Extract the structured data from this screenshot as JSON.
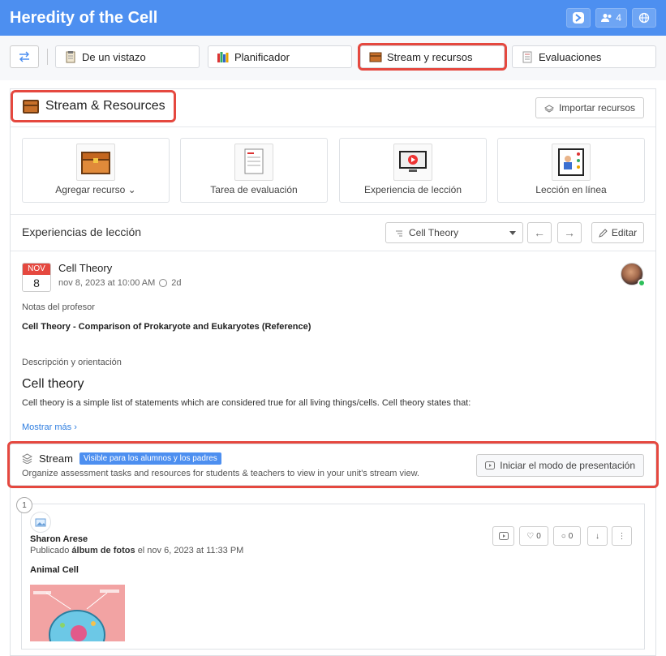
{
  "app": {
    "title": "Heredity of the Cell",
    "members_count": "4"
  },
  "tabs": [
    {
      "label": "De un vistazo"
    },
    {
      "label": "Planificador"
    },
    {
      "label": "Stream y recursos"
    },
    {
      "label": "Evaluaciones"
    }
  ],
  "header": {
    "title": "Stream & Resources",
    "import_label": "Importar recursos"
  },
  "cards": [
    {
      "label": "Agregar recurso"
    },
    {
      "label": "Tarea de evaluación"
    },
    {
      "label": "Experiencia de lección"
    },
    {
      "label": "Lección en línea"
    }
  ],
  "lessons": {
    "heading": "Experiencias de lección",
    "selected": "Cell Theory",
    "edit_label": "Editar"
  },
  "lesson": {
    "month": "NOV",
    "day": "8",
    "title": "Cell Theory",
    "date": "nov 8, 2023 at 10:00 AM",
    "duration": "2d",
    "notes_label": "Notas del profesor",
    "notes": "Cell Theory - Comparison of Prokaryote and Eukaryotes (Reference)",
    "desc_label": "Descripción y orientación",
    "heading": "Cell theory",
    "paragraph": "Cell theory is a simple list of statements which are considered true for all living things/cells. Cell theory states that:",
    "show_more": "Mostrar más"
  },
  "stream": {
    "title": "Stream",
    "badge": "Visible para los alumnos y los padres",
    "desc": "Organize assessment tasks and resources for students & teachers to view in your unit's stream view.",
    "present_label": "Iniciar el modo de presentación"
  },
  "post": {
    "number": "1",
    "author": "Sharon Arese",
    "published_prefix": "Publicado",
    "album": "álbum de fotos",
    "published_suffix": "el nov 6, 2023 at 11:33 PM",
    "title": "Animal Cell",
    "likes": "0",
    "comments": "0"
  }
}
